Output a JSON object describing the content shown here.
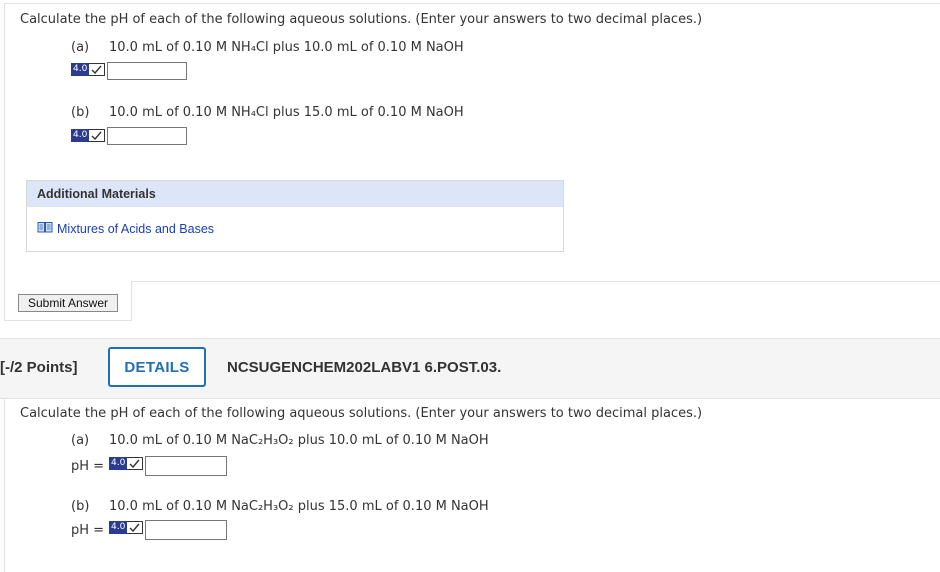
{
  "question1": {
    "prompt": "Calculate the pH of each of the following aqueous solutions. (Enter your answers to two decimal places.)",
    "parts": [
      {
        "label": "(a)",
        "text": "10.0 mL of 0.10 M NH₄Cl plus 10.0 mL of 0.10 M NaOH",
        "badge": "4.0",
        "value": ""
      },
      {
        "label": "(b)",
        "text": "10.0 mL of 0.10 M NH₄Cl plus 15.0 mL of 0.10 M NaOH",
        "badge": "4.0",
        "value": ""
      }
    ]
  },
  "additional_materials": {
    "title": "Additional Materials",
    "link": "Mixtures of Acids and Bases",
    "link_icon": "book-icon"
  },
  "submit_label": "Submit Answer",
  "question2": {
    "points": "[-/2 Points]",
    "details_label": "DETAILS",
    "code": "NCSUGENCHEM202LABV1 6.POST.03.",
    "prompt": "Calculate the pH of each of the following aqueous solutions. (Enter your answers to two decimal places.)",
    "parts": [
      {
        "label": "(a)",
        "text": "10.0 mL of 0.10 M NaC₂H₃O₂ plus 10.0 mL of 0.10 M NaOH",
        "prefix": "pH =",
        "badge": "4.0",
        "value": ""
      },
      {
        "label": "(b)",
        "text": "10.0 mL of 0.10 M NaC₂H₃O₂ plus 15.0 mL of 0.10 M NaOH",
        "prefix": "pH =",
        "badge": "4.0",
        "value": ""
      }
    ]
  },
  "colors": {
    "accent": "#1f6fb5",
    "badge_bg": "#2b3c8f",
    "materials_header_bg": "#dce6f8",
    "link": "#1a3eb5"
  }
}
